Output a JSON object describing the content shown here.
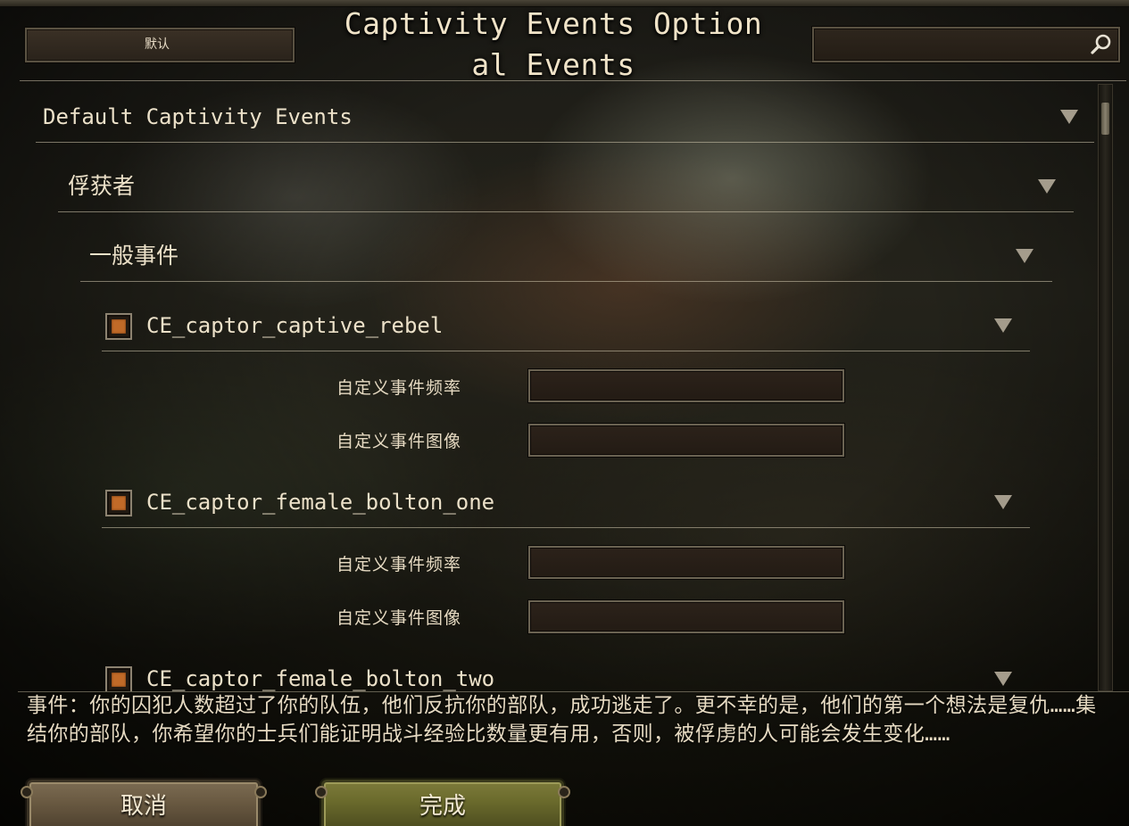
{
  "window": {
    "title_line1": "Captivity Events Option",
    "title_line2": "al Events"
  },
  "header": {
    "default_label": "默认",
    "search_value": ""
  },
  "tree": {
    "root_label": "Default Captivity Events",
    "group_label": "俘获者",
    "subgroup_label": "一般事件",
    "events": [
      {
        "name": "CE_captor_captive_rebel",
        "checked": true,
        "frequency_label": "自定义事件频率",
        "frequency_value": "",
        "image_label": "自定义事件图像",
        "image_value": ""
      },
      {
        "name": "CE_captor_female_bolton_one",
        "checked": true,
        "frequency_label": "自定义事件频率",
        "frequency_value": "",
        "image_label": "自定义事件图像",
        "image_value": ""
      },
      {
        "name": "CE_captor_female_bolton_two",
        "checked": true
      }
    ]
  },
  "description": {
    "text": "事件：你的囚犯人数超过了你的队伍，他们反抗你的部队，成功逃走了。更不幸的是，他们的第一个想法是复仇……集结你的部队，你希望你的士兵们能证明战斗经验比数量更有用，否则，被俘虏的人可能会发生变化……"
  },
  "footer": {
    "cancel_label": "取消",
    "done_label": "完成"
  },
  "colors": {
    "checkbox_fill": "#c06a28",
    "done_button": "#6a6a2c",
    "cancel_button": "#6a5a42",
    "text": "#e8dcc6"
  }
}
